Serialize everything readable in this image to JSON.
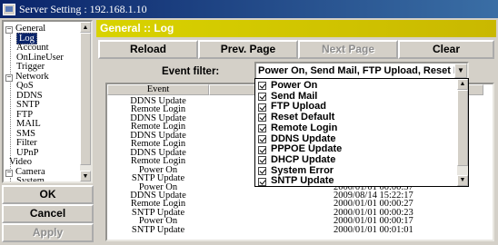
{
  "window": {
    "title": "Server Setting : 192.168.1.10"
  },
  "tree": [
    {
      "label": "General",
      "expander": "−",
      "selected": false
    },
    {
      "label": "Log",
      "expander": "",
      "selected": true
    },
    {
      "label": "Account",
      "expander": "",
      "selected": false
    },
    {
      "label": "OnLineUser",
      "expander": "",
      "selected": false
    },
    {
      "label": "Trigger",
      "expander": "",
      "selected": false
    },
    {
      "label": "Network",
      "expander": "−",
      "selected": false
    },
    {
      "label": "QoS",
      "expander": "",
      "selected": false
    },
    {
      "label": "DDNS",
      "expander": "",
      "selected": false
    },
    {
      "label": "SNTP",
      "expander": "",
      "selected": false
    },
    {
      "label": "FTP",
      "expander": "",
      "selected": false
    },
    {
      "label": "MAIL",
      "expander": "",
      "selected": false
    },
    {
      "label": "SMS",
      "expander": "",
      "selected": false
    },
    {
      "label": "Filter",
      "expander": "",
      "selected": false
    },
    {
      "label": "UPnP",
      "expander": "",
      "selected": false
    },
    {
      "label": "Video",
      "expander": "",
      "selected": false
    },
    {
      "label": "Camera",
      "expander": "−",
      "selected": false
    },
    {
      "label": "System",
      "expander": "",
      "selected": false
    }
  ],
  "side_buttons": {
    "ok": "OK",
    "cancel": "Cancel",
    "apply": "Apply"
  },
  "header": {
    "title": "General :: Log"
  },
  "toolbar": {
    "reload": "Reload",
    "prev_page": "Prev. Page",
    "next_page": "Next Page",
    "clear": "Clear"
  },
  "filter": {
    "label": "Event filter:",
    "value": "Power On, Send Mail, FTP Upload, Reset D..."
  },
  "filter_options": [
    {
      "label": "Power On",
      "checked": true
    },
    {
      "label": "Send Mail",
      "checked": true
    },
    {
      "label": "FTP Upload",
      "checked": true
    },
    {
      "label": "Reset Default",
      "checked": true
    },
    {
      "label": "Remote Login",
      "checked": true
    },
    {
      "label": "DDNS Update",
      "checked": true
    },
    {
      "label": "PPPOE Update",
      "checked": true
    },
    {
      "label": "DHCP Update",
      "checked": true
    },
    {
      "label": "System Error",
      "checked": true
    },
    {
      "label": "SNTP Update",
      "checked": true
    }
  ],
  "log": {
    "columns": [
      "Event",
      "T"
    ],
    "rows": [
      {
        "event": "DDNS Update",
        "time": ""
      },
      {
        "event": "Remote Login",
        "time": ""
      },
      {
        "event": "DDNS Update",
        "time": ""
      },
      {
        "event": "Remote Login",
        "time": ""
      },
      {
        "event": "DDNS Update",
        "time": ""
      },
      {
        "event": "Remote Login",
        "time": ""
      },
      {
        "event": "DDNS Update",
        "time": ""
      },
      {
        "event": "Remote Login",
        "time": ""
      },
      {
        "event": "Power On",
        "time": ""
      },
      {
        "event": "SNTP Update",
        "time": ""
      },
      {
        "event": "Power On",
        "time": "2000/01/01 00:00:37"
      },
      {
        "event": "DDNS Update",
        "time": "2009/08/14 15:22:17"
      },
      {
        "event": "Remote Login",
        "time": "2000/01/01 00:00:27"
      },
      {
        "event": "SNTP Update",
        "time": "2000/01/01 00:00:23"
      },
      {
        "event": "Power On",
        "time": "2000/01/01 00:00:17"
      },
      {
        "event": "SNTP Update",
        "time": "2000/01/01 00:01:01"
      }
    ]
  }
}
